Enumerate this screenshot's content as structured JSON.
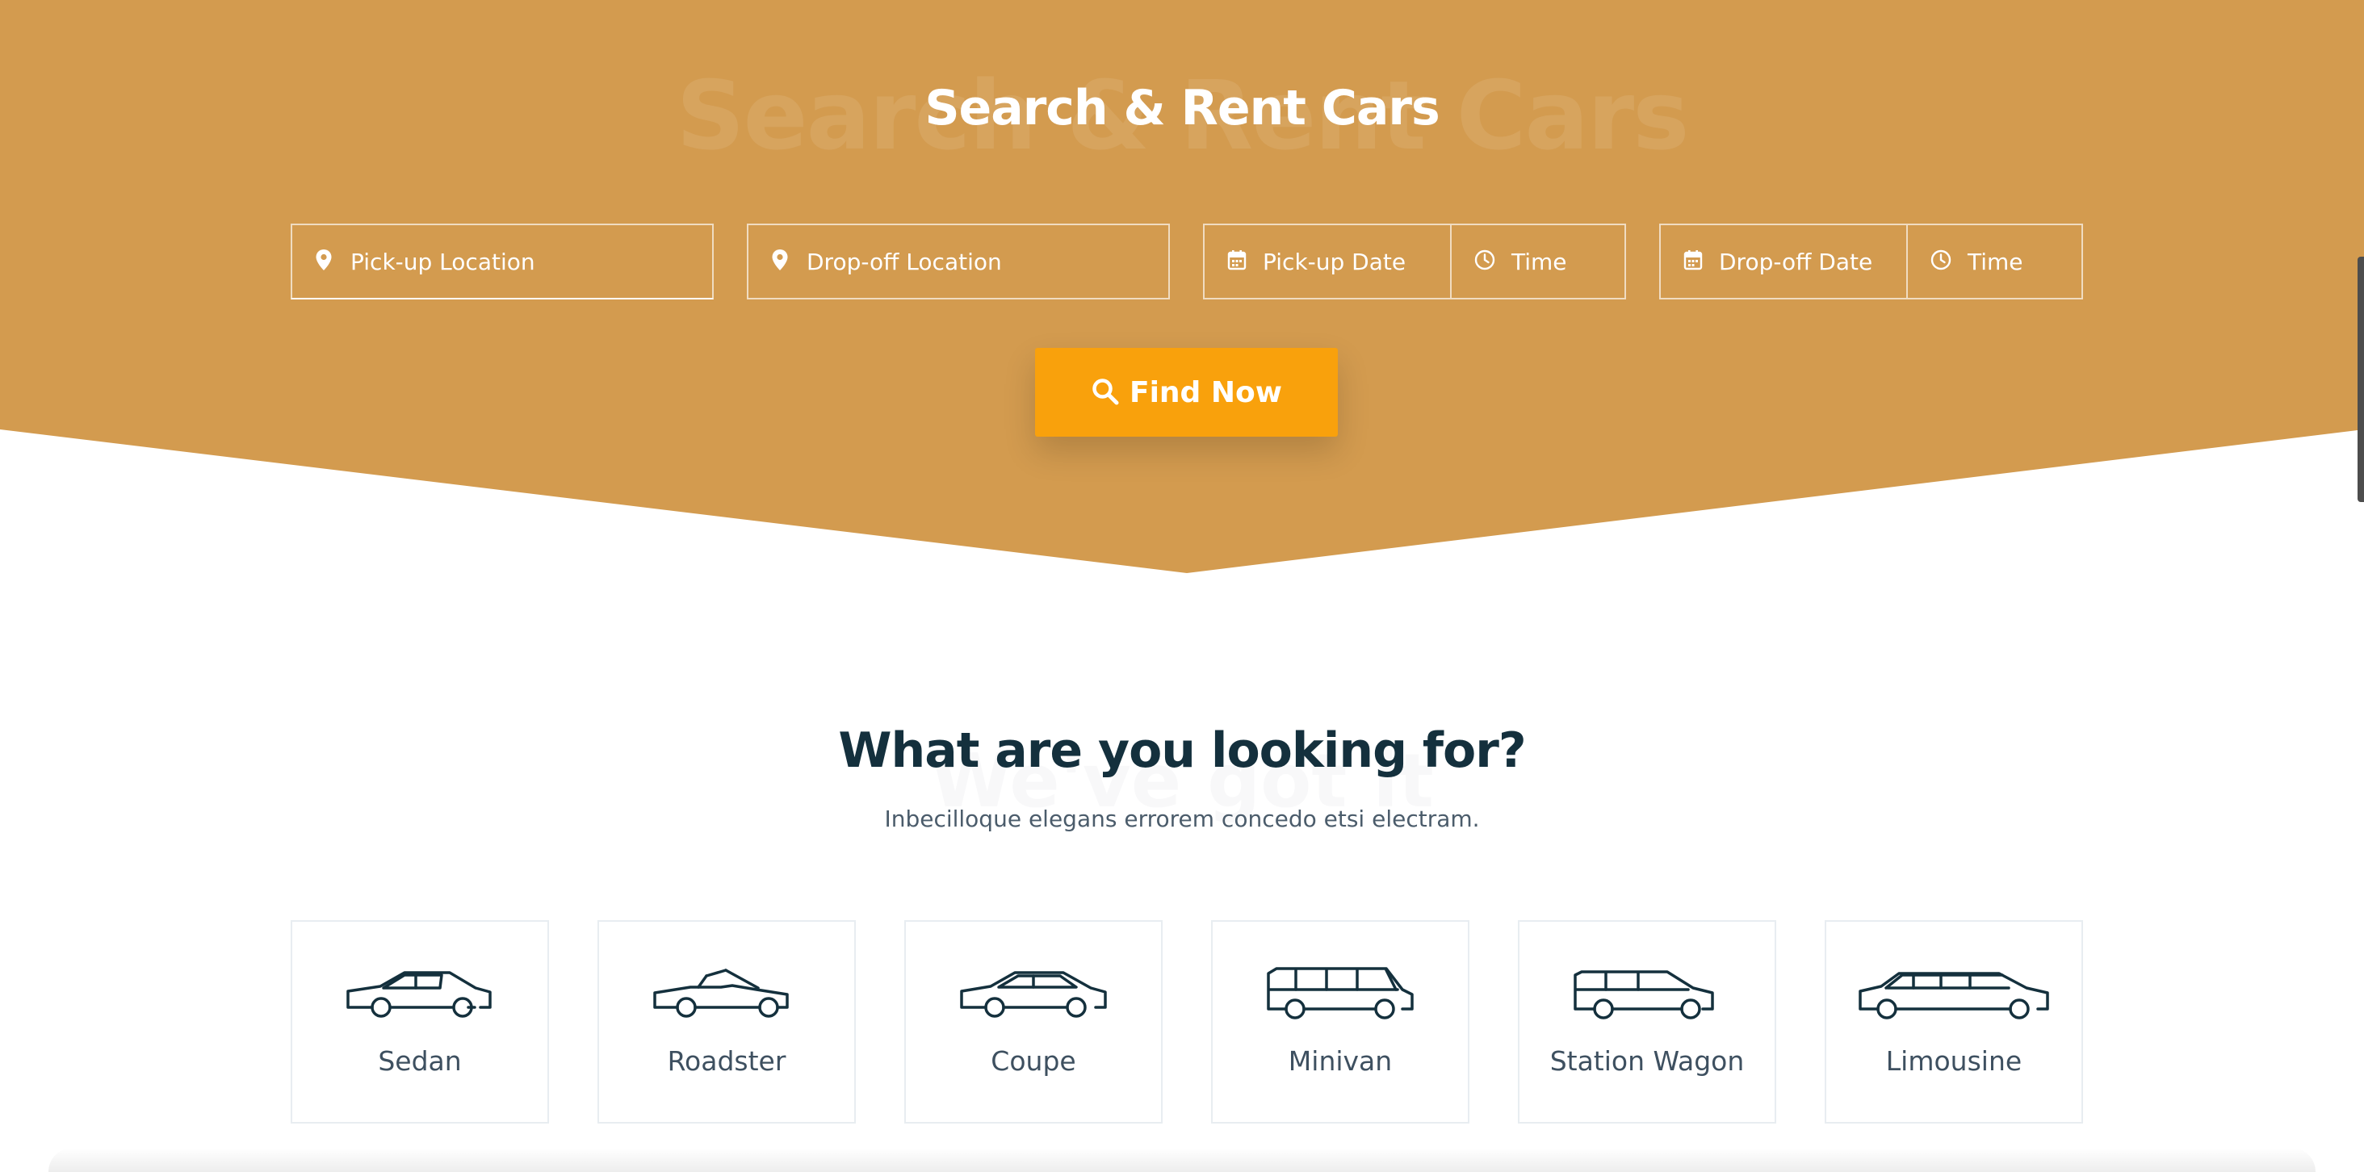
{
  "colors": {
    "hero_bg": "#d39b4f",
    "accent": "#f9a10c",
    "heading": "#14303d",
    "card_border": "#e8edf1"
  },
  "hero": {
    "ghost_title": "Search & Rent Cars",
    "title": "Search & Rent Cars",
    "pickup_location": {
      "placeholder": "Pick-up Location",
      "icon": "map-pin-icon"
    },
    "dropoff_location": {
      "placeholder": "Drop-off Location",
      "icon": "map-pin-icon"
    },
    "pickup_date": {
      "placeholder": "Pick-up Date",
      "icon": "calendar-icon"
    },
    "pickup_time": {
      "placeholder": "Time",
      "icon": "clock-icon"
    },
    "dropoff_date": {
      "placeholder": "Drop-off Date",
      "icon": "calendar-icon"
    },
    "dropoff_time": {
      "placeholder": "Time",
      "icon": "clock-icon"
    },
    "find_button": {
      "label": "Find Now",
      "icon": "search-icon"
    }
  },
  "categories_section": {
    "ghost_text": "We've got it",
    "title": "What are you looking for?",
    "subtitle": "Inbecilloque elegans errorem concedo etsi electram.",
    "cards": [
      {
        "label": "Sedan",
        "icon": "sedan-icon"
      },
      {
        "label": "Roadster",
        "icon": "roadster-icon"
      },
      {
        "label": "Coupe",
        "icon": "coupe-icon"
      },
      {
        "label": "Minivan",
        "icon": "minivan-icon"
      },
      {
        "label": "Station Wagon",
        "icon": "station-wagon-icon"
      },
      {
        "label": "Limousine",
        "icon": "limousine-icon"
      }
    ]
  }
}
